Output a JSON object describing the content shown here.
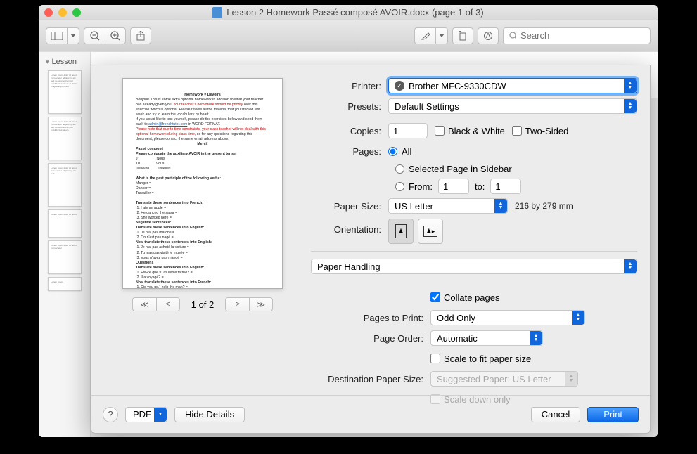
{
  "window": {
    "title": "Lesson 2 Homework Passé composé AVOIR.docx (page 1 of 3)"
  },
  "toolbar": {
    "search_placeholder": "Search"
  },
  "sidebar": {
    "header": "Lesson"
  },
  "dialog": {
    "printer_label": "Printer:",
    "printer_value": "Brother MFC-9330CDW",
    "presets_label": "Presets:",
    "presets_value": "Default Settings",
    "copies_label": "Copies:",
    "copies_value": "1",
    "bw_label": "Black & White",
    "twosided_label": "Two-Sided",
    "pages_label": "Pages:",
    "pages_all": "All",
    "pages_selected": "Selected Page in Sidebar",
    "pages_from": "From:",
    "pages_to": "to:",
    "from_value": "1",
    "to_value": "1",
    "papersize_label": "Paper Size:",
    "papersize_value": "US Letter",
    "papersize_hint": "216 by 279 mm",
    "orientation_label": "Orientation:",
    "section_value": "Paper Handling",
    "collate_label": "Collate pages",
    "pagestoprint_label": "Pages to Print:",
    "pagestoprint_value": "Odd Only",
    "pageorder_label": "Page Order:",
    "pageorder_value": "Automatic",
    "scalefit_label": "Scale to fit paper size",
    "destsize_label": "Destination Paper Size:",
    "destsize_value": "Suggested Paper: US Letter",
    "scaledown_label": "Scale down only",
    "pager_text": "1 of 2"
  },
  "footer": {
    "pdf": "PDF",
    "hide_details": "Hide Details",
    "cancel": "Cancel",
    "print": "Print"
  }
}
